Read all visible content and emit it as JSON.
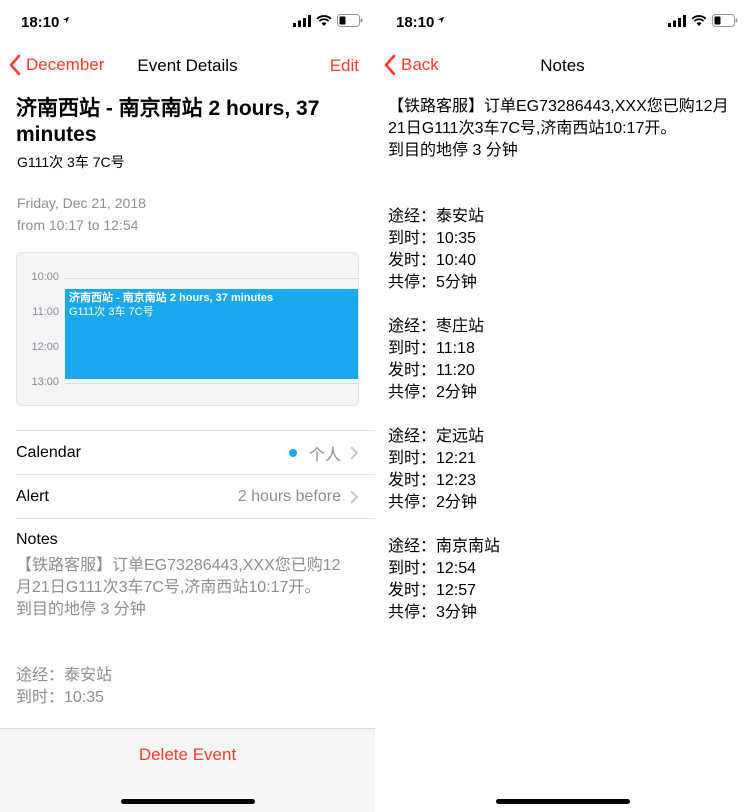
{
  "left": {
    "status": {
      "time": "18:10"
    },
    "nav": {
      "back_label": "December",
      "title": "Event Details",
      "edit_label": "Edit"
    },
    "event": {
      "title": "济南西站 - 南京南站 2 hours, 37 minutes",
      "subtitle": "G111次 3车 7C号",
      "date": "Friday, Dec 21, 2018",
      "time_range": "from 10:17 to 12:54"
    },
    "calendar_preview": {
      "hours": [
        "10:00",
        "11:00",
        "12:00",
        "13:00"
      ],
      "event_title": "济南西站 - 南京南站 2 hours, 37 minutes",
      "event_sub": "G111次 3车 7C号",
      "event_color": "#1aa8ee"
    },
    "rows": {
      "calendar_label": "Calendar",
      "calendar_value": "个人",
      "alert_label": "Alert",
      "alert_value": "2 hours before"
    },
    "notes": {
      "label": "Notes",
      "text": "【铁路客服】订单EG73286443,XXX您已购12月21日G111次3车7C号,济南西站10:17开。\n到目的地停 3 分钟\n\n\n途经：泰安站\n到时：10:35"
    },
    "delete_label": "Delete Event"
  },
  "right": {
    "status": {
      "time": "18:10"
    },
    "nav": {
      "back_label": "Back",
      "title": "Notes"
    },
    "notes_text": "【铁路客服】订单EG73286443,XXX您已购12月21日G111次3车7C号,济南西站10:17开。\n到目的地停 3 分钟\n\n\n途经：泰安站\n到时：10:35\n发时：10:40\n共停：5分钟\n\n途经：枣庄站\n到时：11:18\n发时：11:20\n共停：2分钟\n\n途经：定远站\n到时：12:21\n发时：12:23\n共停：2分钟\n\n途经：南京南站\n到时：12:54\n发时：12:57\n共停：3分钟"
  },
  "colors": {
    "accent": "#ff3b30",
    "calendar_blue": "#1aa8ee",
    "secondary_text": "#8e8e93"
  },
  "icons": [
    "location-arrow-icon",
    "signal-icon",
    "wifi-icon",
    "battery-icon",
    "chevron-left-icon",
    "chevron-right-icon"
  ]
}
